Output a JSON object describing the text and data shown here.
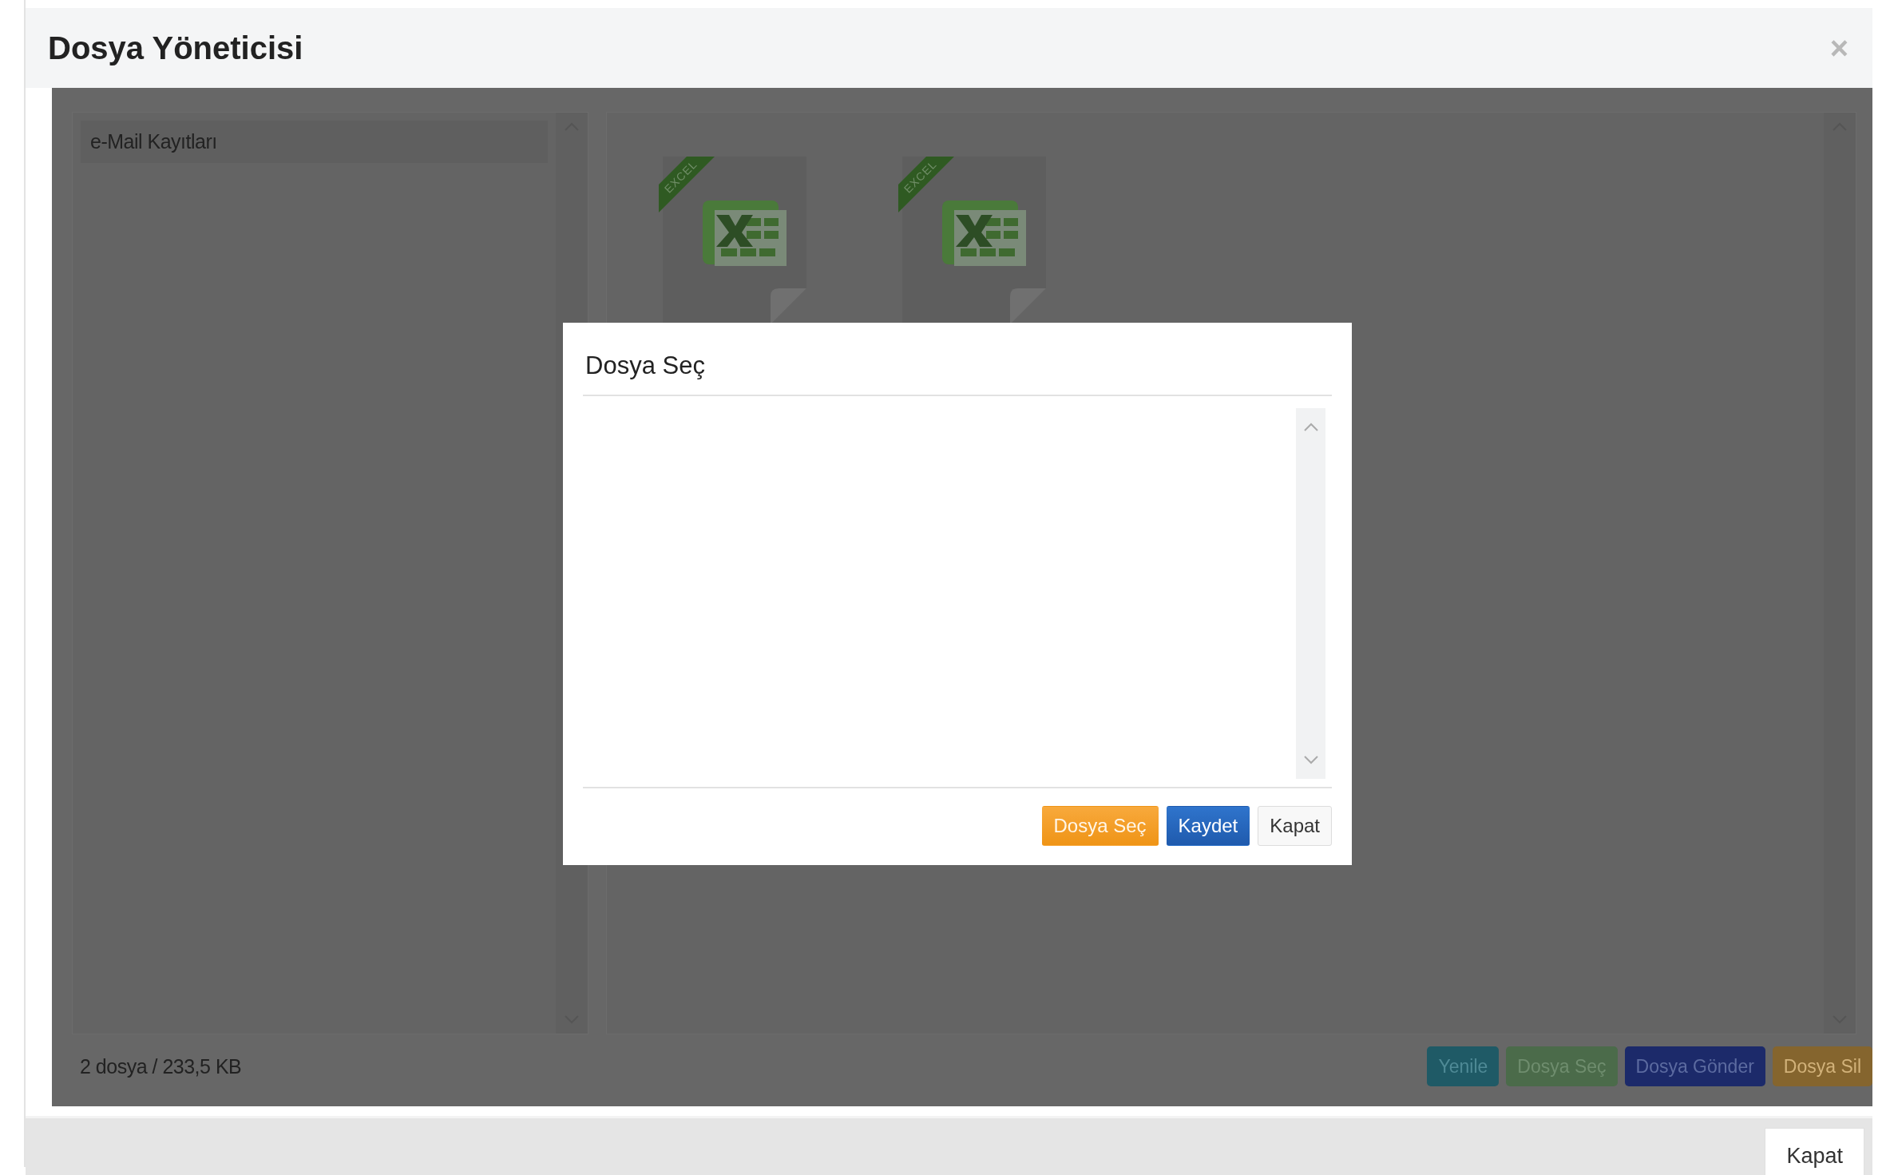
{
  "window": {
    "title": "Dosya Yöneticisi",
    "close": "×"
  },
  "sidebar": {
    "items": [
      {
        "label": "e-Mail Kayıtları"
      }
    ]
  },
  "files": [
    {
      "badge": "EXCEL"
    },
    {
      "badge": "EXCEL"
    }
  ],
  "status": "2 dosya / 233,5 KB",
  "toolbar_buttons": [
    {
      "label": "Yenile",
      "color": "#1f5a66"
    },
    {
      "label": "Dosya Seç",
      "color": "#4b6b4a"
    },
    {
      "label": "Dosya Gönder",
      "color": "#1c2a6a"
    },
    {
      "label": "Dosya Sil",
      "color": "#85652e"
    }
  ],
  "dialog": {
    "title": "Dosya Seç",
    "buttons": [
      {
        "label": "Dosya Seç",
        "kind": "warning"
      },
      {
        "label": "Kaydet",
        "kind": "primary"
      },
      {
        "label": "Kapat",
        "kind": "default"
      }
    ]
  },
  "footer": {
    "buttons": [
      {
        "label": "Kapat"
      }
    ]
  }
}
